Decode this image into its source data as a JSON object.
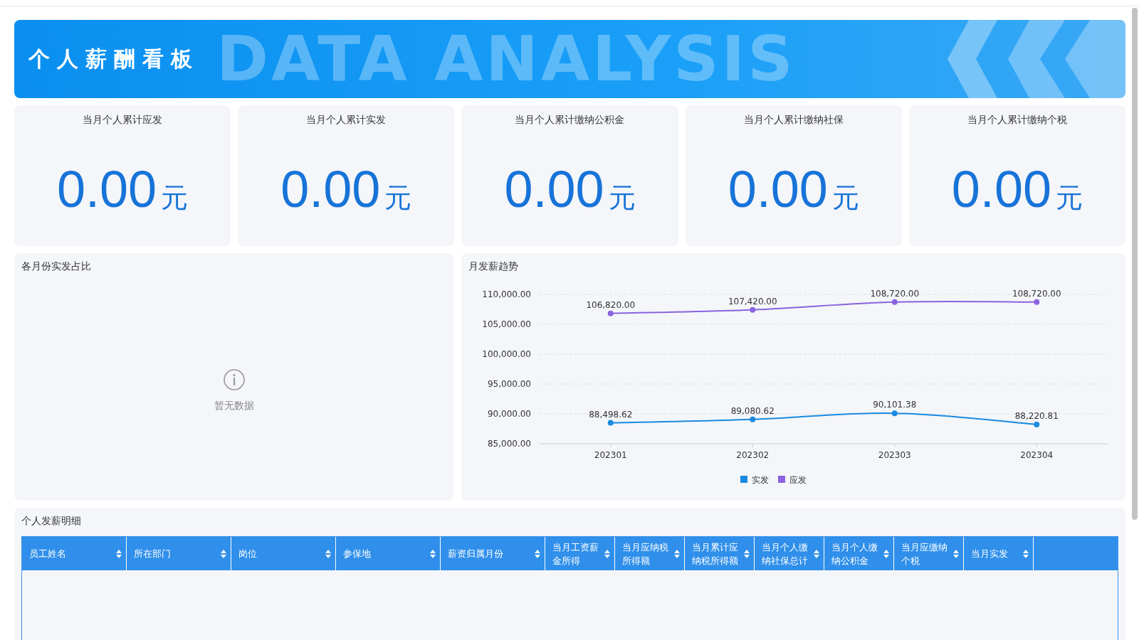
{
  "banner": {
    "title": "个人薪酬看板",
    "background_text": "DATA ANALYSIS"
  },
  "kpis": [
    {
      "label": "当月个人累计应发",
      "value": "0.00",
      "unit": "元"
    },
    {
      "label": "当月个人累计实发",
      "value": "0.00",
      "unit": "元"
    },
    {
      "label": "当月个人累计缴纳公积金",
      "value": "0.00",
      "unit": "元"
    },
    {
      "label": "当月个人累计缴纳社保",
      "value": "0.00",
      "unit": "元"
    },
    {
      "label": "当月个人累计缴纳个税",
      "value": "0.00",
      "unit": "元"
    }
  ],
  "pie_panel": {
    "title": "各月份实发占比",
    "empty_text": "暂无数据"
  },
  "trend_panel": {
    "title": "月发薪趋势",
    "chart_data": {
      "type": "line",
      "categories": [
        "202301",
        "202302",
        "202303",
        "202304"
      ],
      "series": [
        {
          "name": "实发",
          "color": "#1a8ae0",
          "marker": "circle",
          "values": [
            88498.62,
            89080.62,
            90101.38,
            88220.81
          ],
          "value_labels": [
            "88,498.62",
            "89,080.62",
            "90,101.38",
            "88,220.81"
          ]
        },
        {
          "name": "应发",
          "color": "#8a63e0",
          "marker": "circle",
          "values": [
            106820,
            107420,
            108720,
            108720
          ],
          "value_labels": [
            "106,820.00",
            "107,420.00",
            "108,720.00",
            "108,720.00"
          ]
        }
      ],
      "ylim": [
        85000,
        110000
      ],
      "yticks": [
        {
          "value": 85000,
          "label": "85,000.00"
        },
        {
          "value": 90000,
          "label": "90,000.00"
        },
        {
          "value": 95000,
          "label": "95,000.00"
        },
        {
          "value": 100000,
          "label": "100,000.00"
        },
        {
          "value": 105000,
          "label": "105,000.00"
        },
        {
          "value": 110000,
          "label": "110,000.00"
        }
      ],
      "data_labels": true,
      "grid": true,
      "legend": true
    }
  },
  "table": {
    "title": "个人发薪明细",
    "columns": [
      {
        "label": "员工姓名"
      },
      {
        "label": "所在部门"
      },
      {
        "label": "岗位"
      },
      {
        "label": "参保地"
      },
      {
        "label": "薪资归属月份"
      },
      {
        "label": "当月工资薪金所得"
      },
      {
        "label": "当月应纳税所得额"
      },
      {
        "label": "当月累计应纳税所得额"
      },
      {
        "label": "当月个人缴纳社保总计"
      },
      {
        "label": "当月个人缴纳公积金"
      },
      {
        "label": "当月应缴纳个税"
      },
      {
        "label": "当月实发"
      }
    ]
  }
}
